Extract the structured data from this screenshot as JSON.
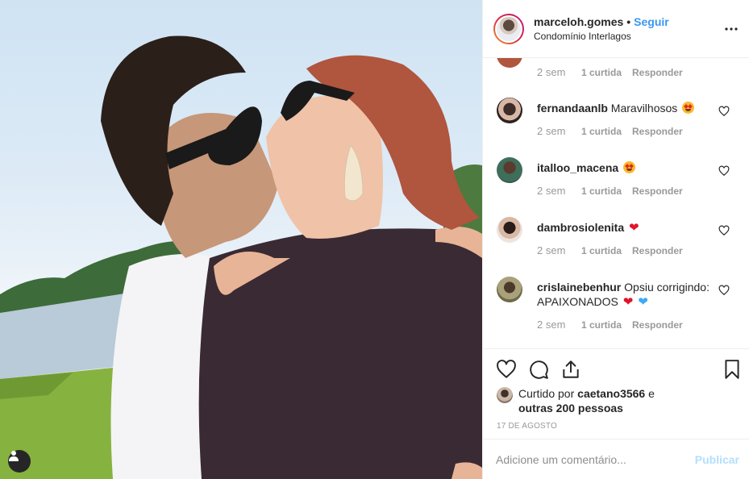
{
  "post": {
    "photo_label": "",
    "header": {
      "username": "marceloh.gomes",
      "separator": "•",
      "follow_label": "Seguir",
      "location": "Condomínio Interlagos"
    },
    "previous_comment_meta": {
      "time": "2 sem",
      "likes": "1 curtida",
      "reply": "Responder"
    },
    "comments": [
      {
        "username": "fernandaanlb",
        "text": "Maravilhosos",
        "emoji": "star-struck",
        "time": "2 sem",
        "likes": "1 curtida",
        "reply": "Responder"
      },
      {
        "username": "italloo_macena",
        "text": "",
        "emoji": "star-struck",
        "time": "2 sem",
        "likes": "1 curtida",
        "reply": "Responder"
      },
      {
        "username": "dambrosiolenita",
        "text": "",
        "emoji": "red-heart",
        "time": "2 sem",
        "likes": "1 curtida",
        "reply": "Responder"
      },
      {
        "username": "crislainebenhur",
        "text": "Opsiu corrigindo: APAIXONADOS",
        "emoji": "sparkling-heart blue-heart",
        "time": "2 sem",
        "likes": "1 curtida",
        "reply": "Responder"
      }
    ],
    "likes": {
      "prefix": "Curtido por",
      "user": "caetano3566",
      "connector": "e",
      "others": "outras 200 pessoas"
    },
    "date": "17 DE AGOSTO",
    "add_comment": {
      "placeholder": "Adicione um comentário...",
      "publish_label": "Publicar"
    }
  },
  "colors": {
    "link_blue": "#3897f0",
    "publish_disabled": "#b2dffc",
    "secondary_text": "#999999",
    "border": "#efefef"
  }
}
